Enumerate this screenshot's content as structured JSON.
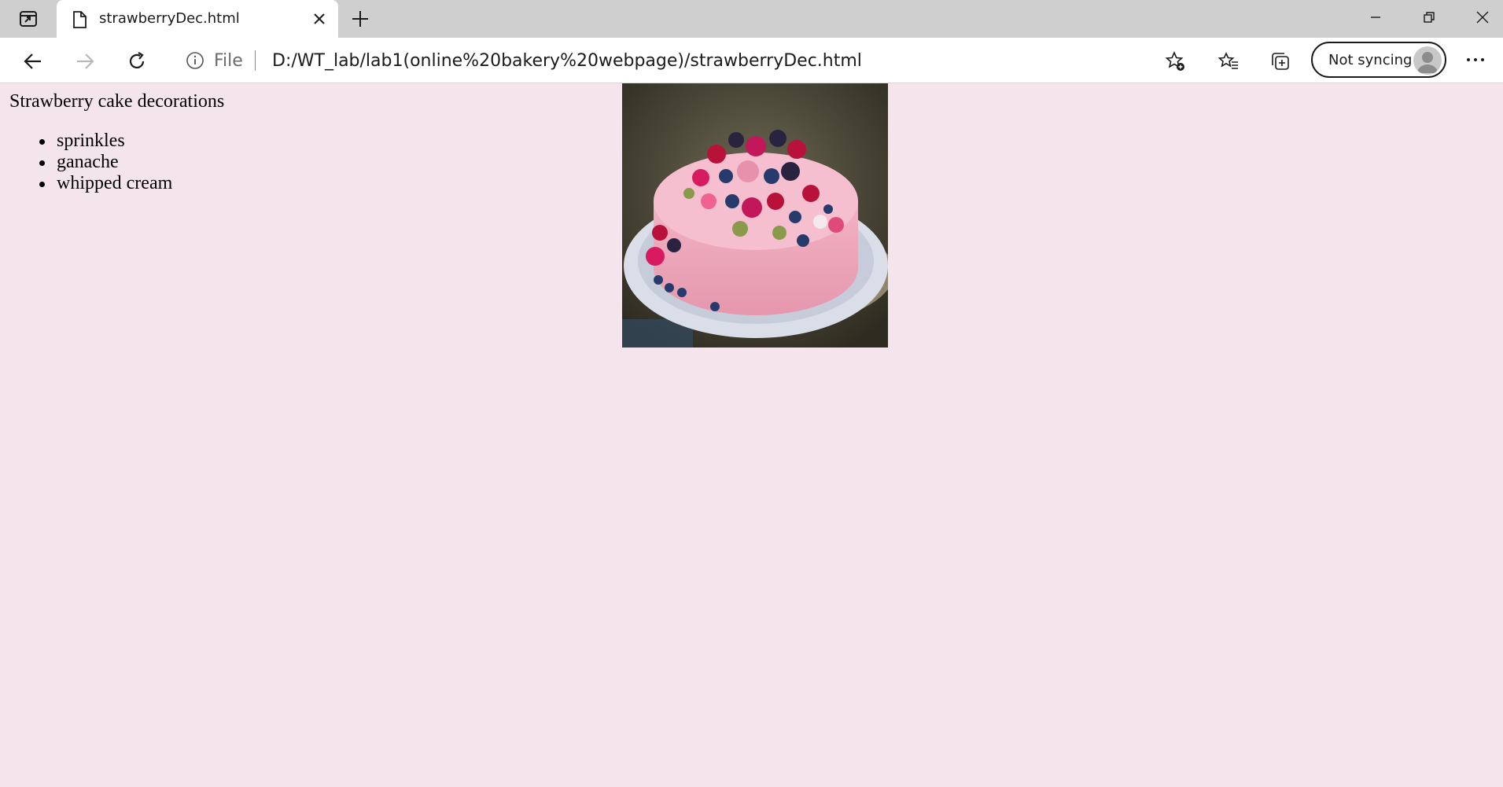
{
  "tab": {
    "title": "strawberryDec.html"
  },
  "address_bar": {
    "scheme_label": "File",
    "url": "D:/WT_lab/lab1(online%20bakery%20webpage)/strawberryDec.html"
  },
  "profile": {
    "label": "Not syncing"
  },
  "page": {
    "heading": "Strawberry cake decorations",
    "decorations": [
      "sprinkles",
      "ganache",
      "whipped cream"
    ]
  }
}
